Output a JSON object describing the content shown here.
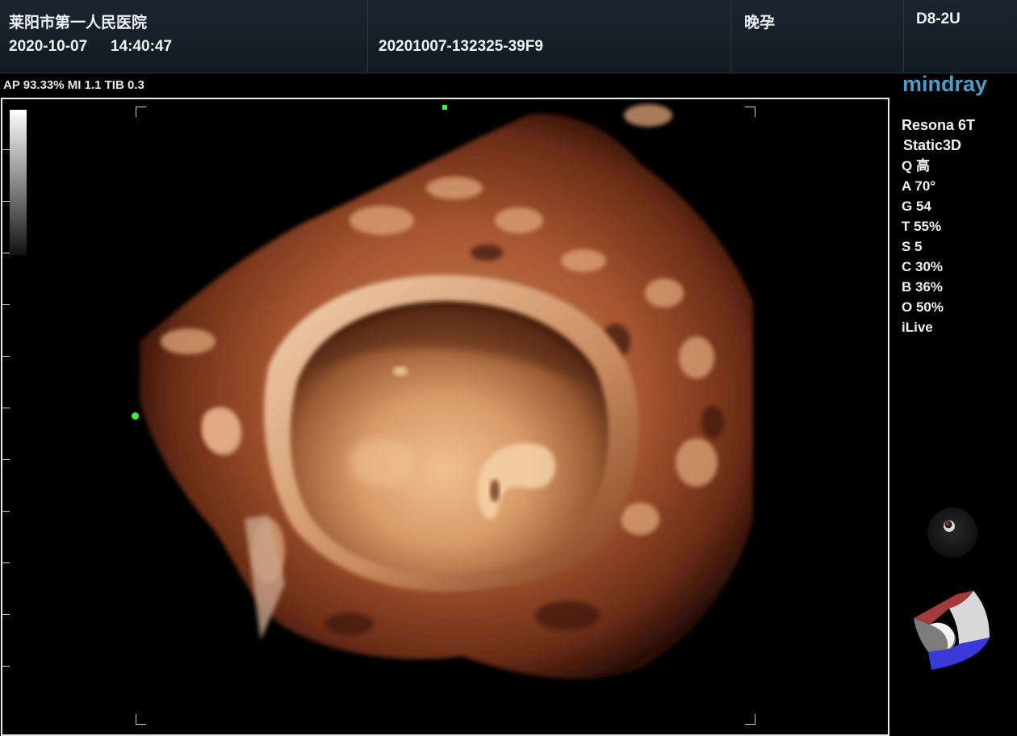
{
  "header": {
    "hospital": "莱阳市第一人民医院",
    "date": "2020-10-07",
    "time": "14:40:47",
    "exam_id": "20201007-132325-39F9",
    "exam_type": "晚孕",
    "probe": "D8-2U"
  },
  "acoustic": {
    "info": "AP 93.33%  MI 1.1 TIB 0.3"
  },
  "brand": {
    "logo": "mindray"
  },
  "system": {
    "model": "Resona 6T",
    "mode": "Static3D"
  },
  "params": [
    "Q 高",
    "A 70°",
    "G 54",
    "T 55%",
    "S 5",
    "C 30%",
    "B 36%",
    "O 50%",
    "iLive"
  ],
  "icons": {
    "grayscale": "grayscale-bar",
    "orientation_ball": "trackball-icon",
    "orientation_cube": "orientation-cube-icon"
  },
  "colors": {
    "brand": "#4a9ec9",
    "marker": "#3ef03e",
    "render_tissue": "#b4653a"
  }
}
